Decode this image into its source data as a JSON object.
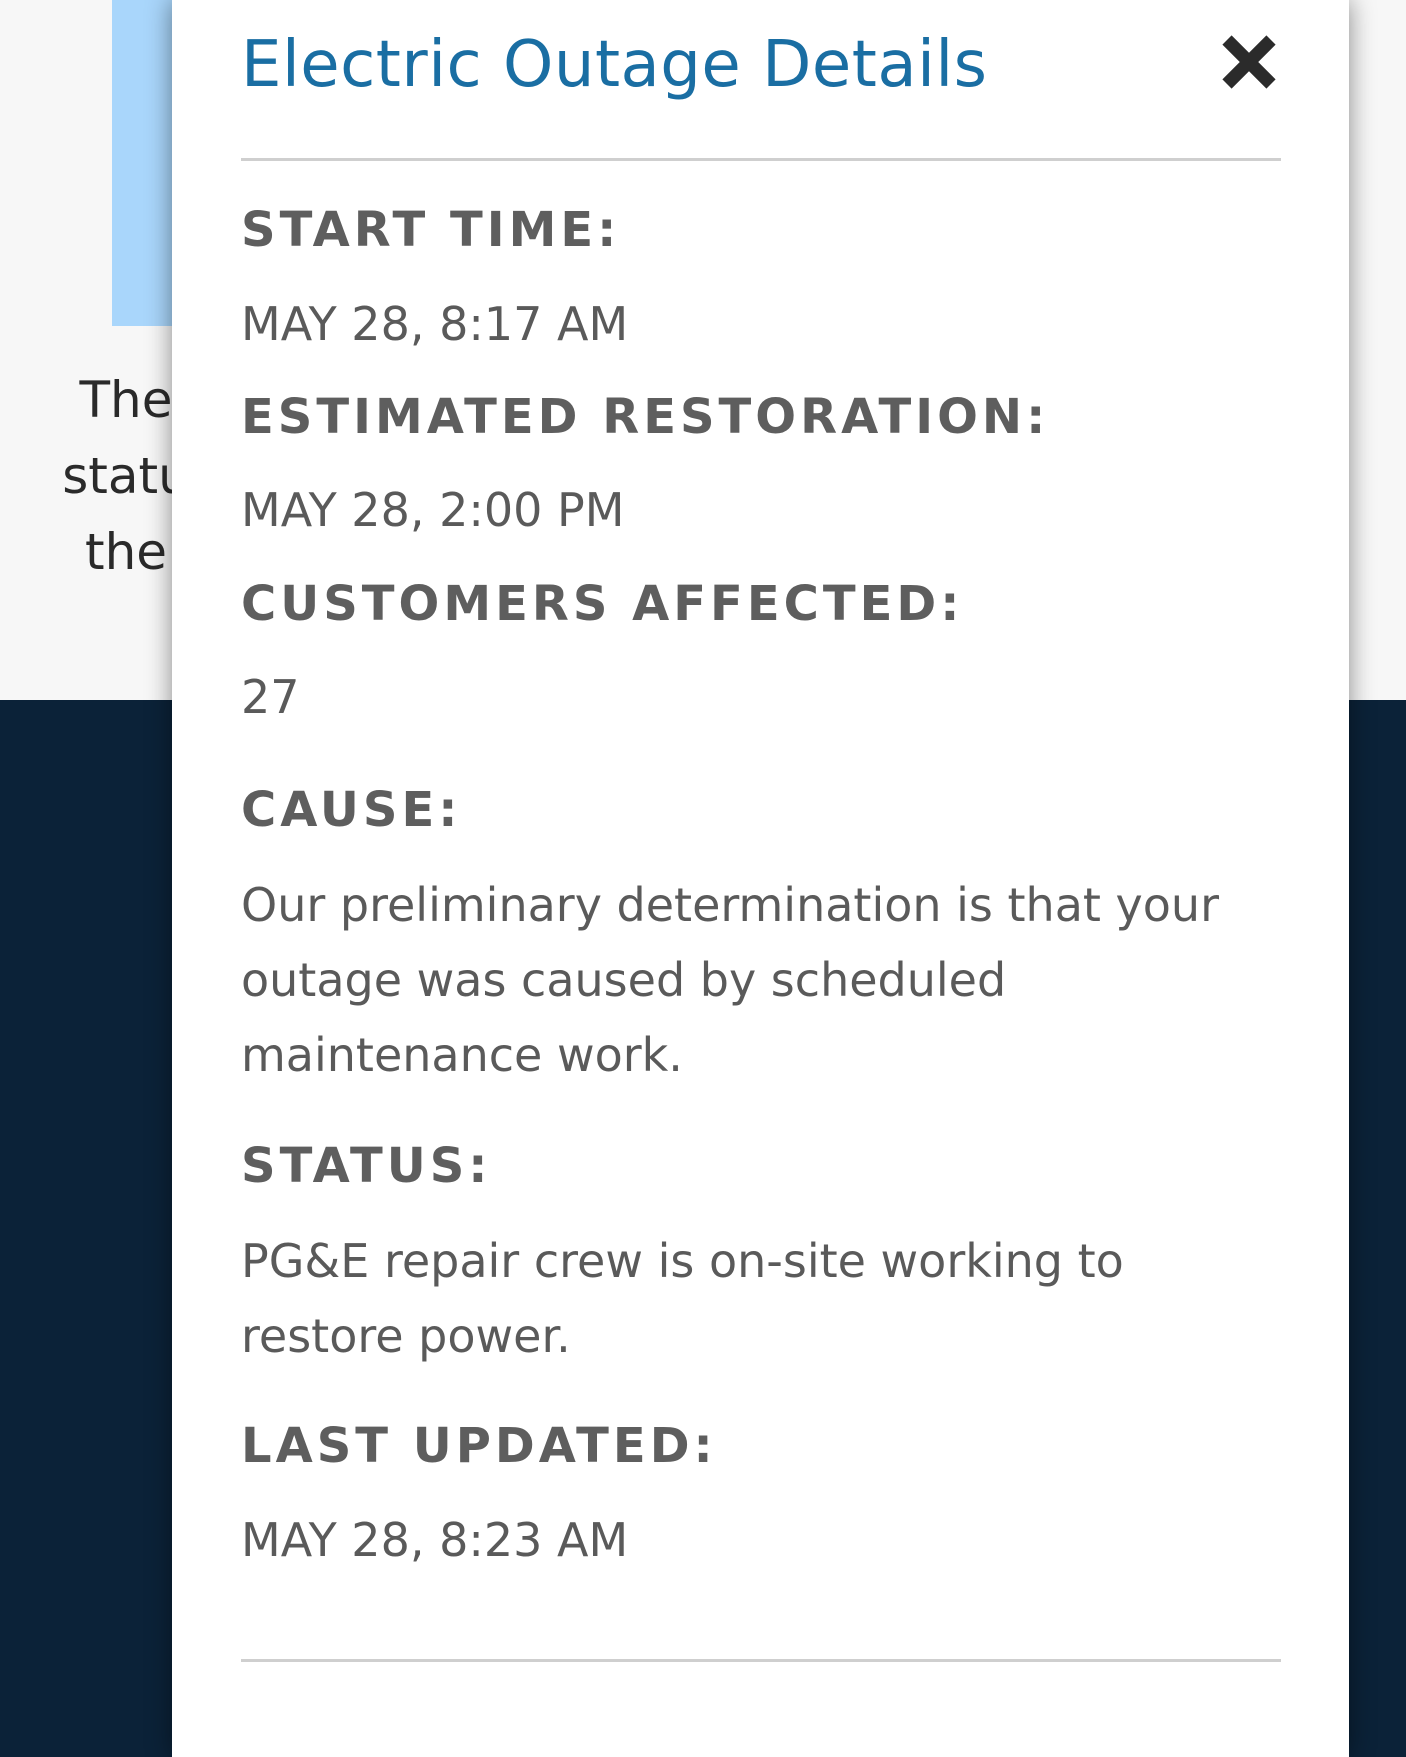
{
  "background": {
    "text_lines": [
      "The",
      "statu",
      "the"
    ]
  },
  "modal": {
    "title": "Electric Outage Details",
    "close_icon": "close-icon",
    "fields": [
      {
        "label": "START TIME:",
        "value": "MAY 28, 8:17 AM"
      },
      {
        "label": "ESTIMATED RESTORATION:",
        "value": "MAY 28, 2:00 PM"
      },
      {
        "label": "CUSTOMERS AFFECTED:",
        "value": "27"
      },
      {
        "label": "CAUSE:",
        "value": "Our preliminary determination is that your outage was caused by scheduled maintenance work."
      },
      {
        "label": "STATUS:",
        "value": "PG&E repair crew is on-site working to restore power."
      },
      {
        "label": "LAST UPDATED:",
        "value": "MAY 28, 8:23 AM"
      }
    ]
  },
  "colors": {
    "title": "#1a6ea3",
    "label": "#5e5e5e",
    "value": "#5a5a5a",
    "dark_background": "#0b2238",
    "map_water": "#a9d6fb"
  }
}
